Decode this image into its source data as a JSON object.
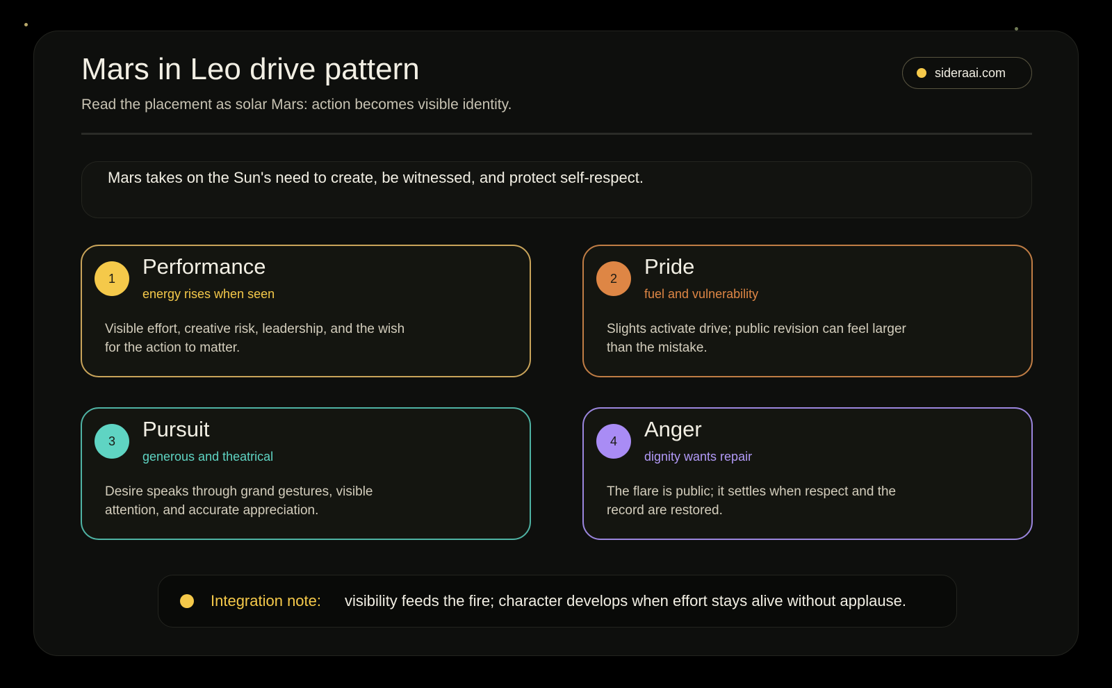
{
  "header": {
    "title": "Mars in Leo drive pattern",
    "subtitle": "Read the placement as solar Mars: action becomes visible identity.",
    "site": "sideraai.com"
  },
  "statement": "Mars takes on the Sun's need to create, be witnessed, and protect self-respect.",
  "tiles": [
    {
      "number": "1",
      "title": "Performance",
      "subtitle": "energy rises when seen",
      "body": "Visible effort, creative risk, leadership, and the wish for the action to matter.",
      "accent": "#f5c94a"
    },
    {
      "number": "2",
      "title": "Pride",
      "subtitle": "fuel and vulnerability",
      "body": "Slights activate drive; public revision can feel larger than the mistake.",
      "accent": "#de8645"
    },
    {
      "number": "3",
      "title": "Pursuit",
      "subtitle": "generous and theatrical",
      "body": "Desire speaks through grand gestures, visible attention, and accurate appreciation.",
      "accent": "#5fd4c3"
    },
    {
      "number": "4",
      "title": "Anger",
      "subtitle": "dignity wants repair",
      "body": "The flare is public; it settles when respect and the record are restored.",
      "accent": "#a98cf5"
    }
  ],
  "note": {
    "label": "Integration note:",
    "text": "visibility feeds the fire; character develops when effort stays alive without applause."
  },
  "colors": {
    "background": "#000000",
    "card": "#0e0f0d",
    "accent_gold": "#f5c94a"
  }
}
